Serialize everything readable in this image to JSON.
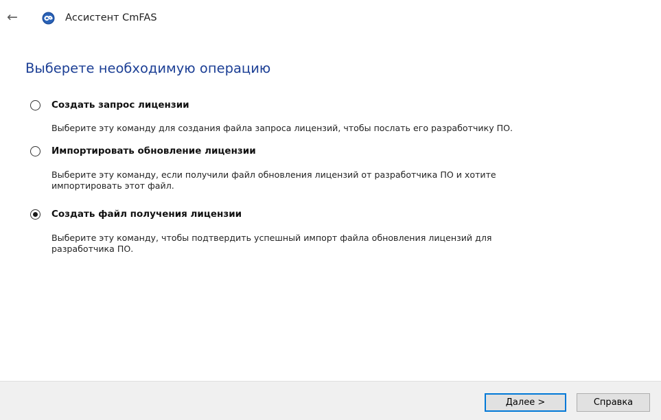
{
  "window": {
    "title": "Ассистент CmFAS",
    "back_icon": "back-arrow-icon",
    "app_icon": "cmfas-app-icon"
  },
  "main": {
    "heading": "Выберете необходимую операцию",
    "options": [
      {
        "label": "Создать запрос лицензии",
        "description": "Выберите эту команду для создания файла запроса лицензий, чтобы послать его разработчику ПО.",
        "selected": false
      },
      {
        "label": "Импортировать обновление лицензии",
        "description_lines": [
          "Выберите эту команду, если получили файл обновления лицензий от разработчика ПО и хотите",
          "импортировать этот файл."
        ],
        "selected": false
      },
      {
        "label": "Создать файл получения лицензии",
        "description_lines": [
          "Выберите эту команду, чтобы подтвердить успешный импорт файла обновления лицензий для",
          "разработчика ПО."
        ],
        "selected": true
      }
    ]
  },
  "footer": {
    "next_label": "Далее >",
    "help_label": "Справка"
  },
  "colors": {
    "heading": "#1c3f95",
    "default_button_border": "#0078d7",
    "footer_bg": "#f0f0f0"
  }
}
